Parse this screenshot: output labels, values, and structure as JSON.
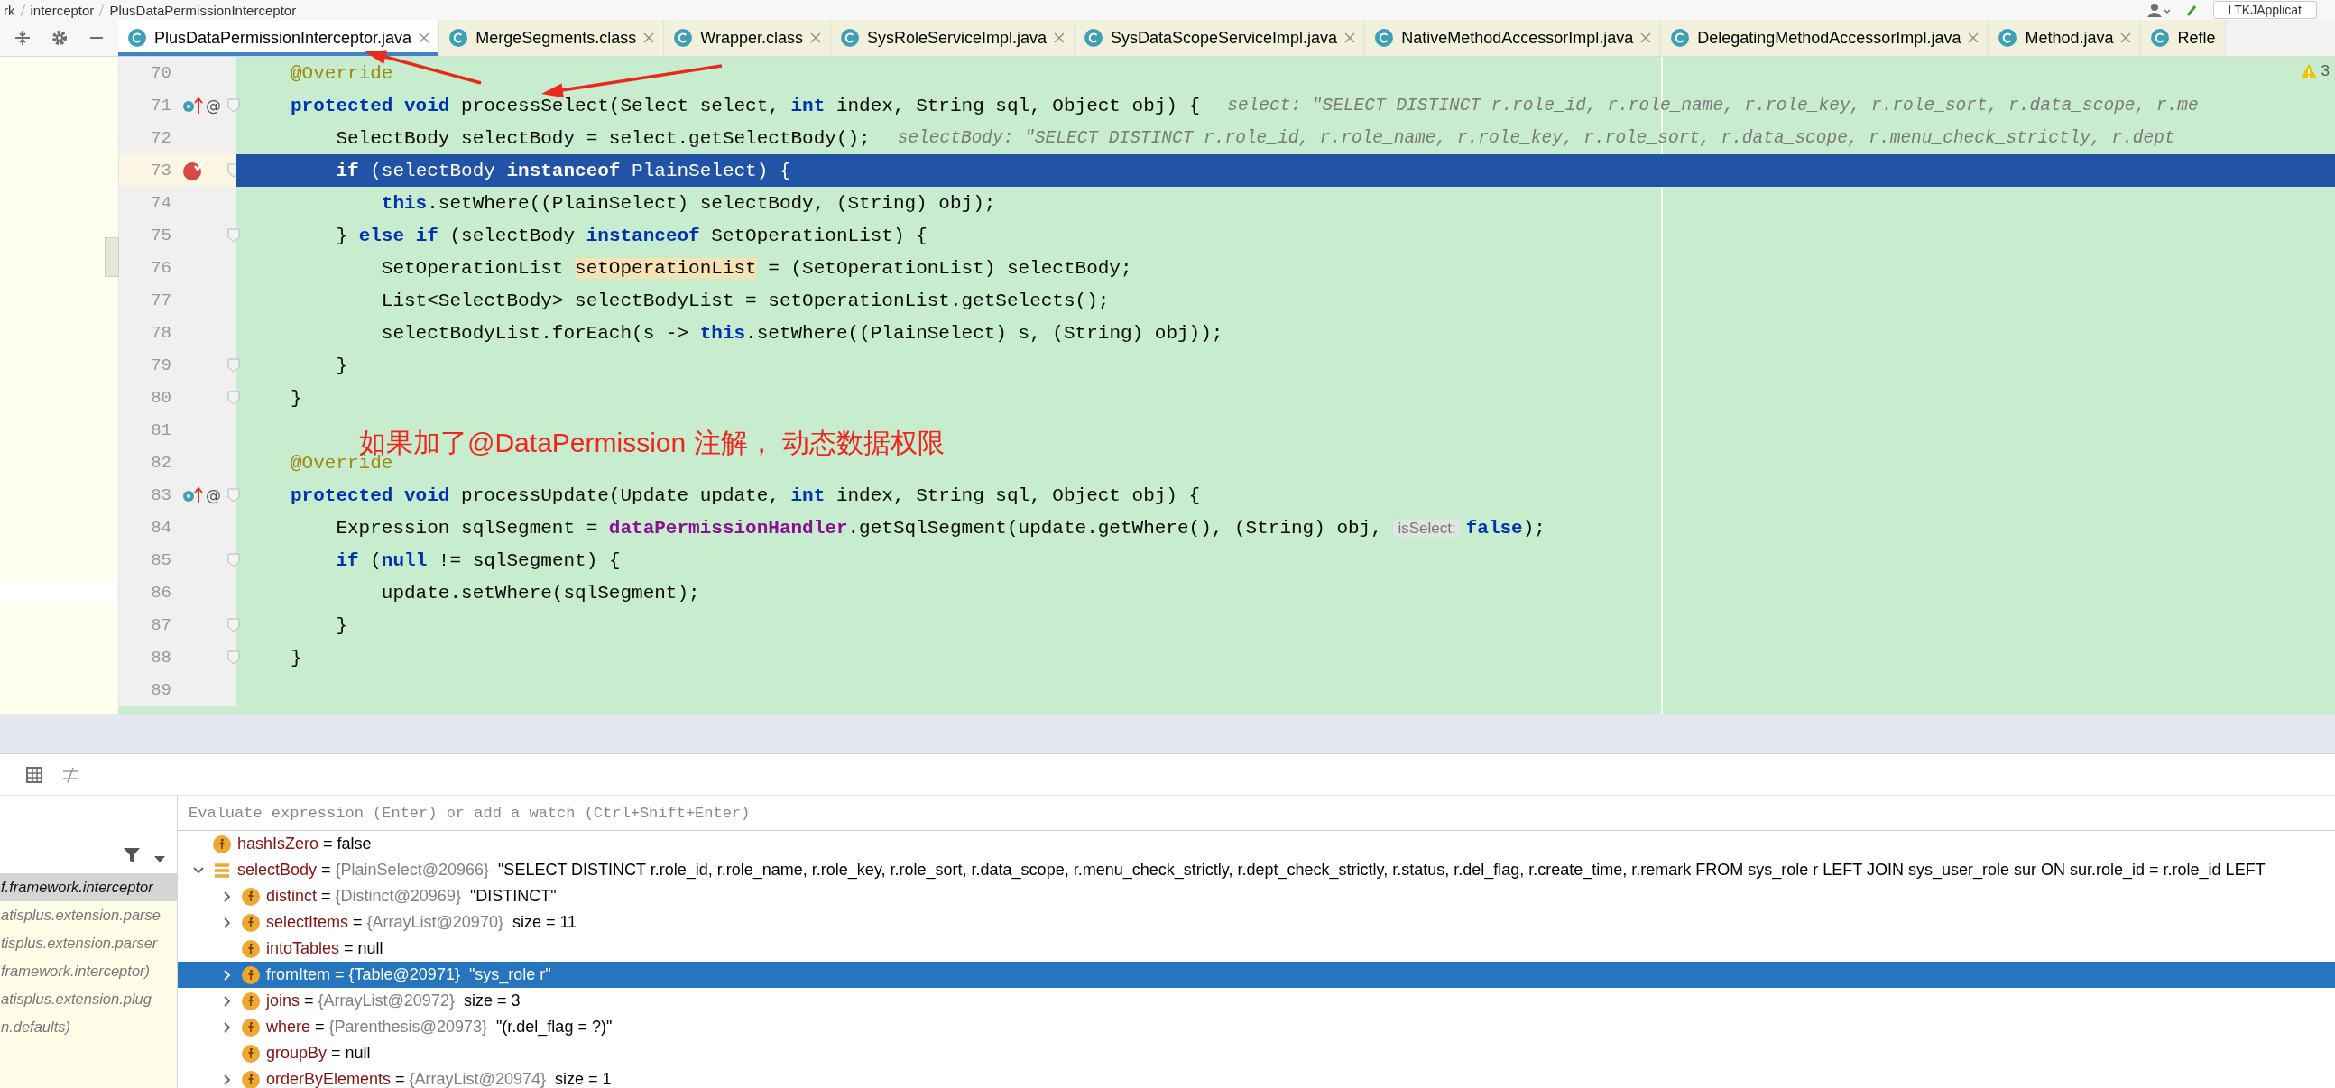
{
  "breadcrumbs": [
    "rk",
    "interceptor",
    "PlusDataPermissionInterceptor"
  ],
  "run_config": {
    "label": "LTKJApplicat"
  },
  "tabs": [
    {
      "label": "PlusDataPermissionInterceptor.java",
      "selected": true
    },
    {
      "label": "MergeSegments.class",
      "selected": false
    },
    {
      "label": "Wrapper.class",
      "selected": false
    },
    {
      "label": "SysRoleServiceImpl.java",
      "selected": false
    },
    {
      "label": "SysDataScopeServiceImpl.java",
      "selected": false
    },
    {
      "label": "NativeMethodAccessorImpl.java",
      "selected": false
    },
    {
      "label": "DelegatingMethodAccessorImpl.java",
      "selected": false
    },
    {
      "label": "Method.java",
      "selected": false
    },
    {
      "label": "Refle",
      "selected": false
    }
  ],
  "editor": {
    "warnings_count": "3",
    "annotation": "如果加了@DataPermission 注解， 动态数据权限",
    "lines": [
      {
        "number": "70",
        "selected": false,
        "breakpoint": false,
        "fold": false,
        "tokens": [
          {
            "kind": "annotation",
            "text": "@Override"
          }
        ]
      },
      {
        "number": "71",
        "selected": false,
        "breakpoint": false,
        "fold": true,
        "override": true,
        "gutter_mark": "@",
        "tokens": [
          {
            "kind": "keyword",
            "text": "protected void"
          },
          {
            "kind": "plain",
            "text": " processSelect(Select select, "
          },
          {
            "kind": "keyword",
            "text": "int"
          },
          {
            "kind": "plain",
            "text": " index, String sql, Object obj) {"
          }
        ],
        "hint": "select: \"SELECT DISTINCT r.role_id, r.role_name, r.role_key, r.role_sort, r.data_scope, r.me"
      },
      {
        "number": "72",
        "selected": false,
        "breakpoint": false,
        "fold": false,
        "tokens": [
          {
            "kind": "plain",
            "text": "    SelectBody selectBody = select.getSelectBody();"
          }
        ],
        "hint": "selectBody: \"SELECT DISTINCT r.role_id, r.role_name, r.role_key, r.role_sort, r.data_scope, r.menu_check_strictly, r.dept"
      },
      {
        "number": "73",
        "selected": true,
        "breakpoint": true,
        "fold": true,
        "tokens": [
          {
            "kind": "keyword",
            "text": "    if"
          },
          {
            "kind": "plain",
            "text": " (selectBody "
          },
          {
            "kind": "keyword",
            "text": "instanceof"
          },
          {
            "kind": "plain",
            "text": " PlainSelect) {"
          }
        ]
      },
      {
        "number": "74",
        "selected": false,
        "breakpoint": false,
        "fold": false,
        "tokens": [
          {
            "kind": "keyword",
            "text": "        this"
          },
          {
            "kind": "plain",
            "text": ".setWhere((PlainSelect) selectBody, (String) obj);"
          }
        ]
      },
      {
        "number": "75",
        "selected": false,
        "breakpoint": false,
        "fold": true,
        "tokens": [
          {
            "kind": "plain",
            "text": "    } "
          },
          {
            "kind": "keyword",
            "text": "else if"
          },
          {
            "kind": "plain",
            "text": " (selectBody "
          },
          {
            "kind": "keyword",
            "text": "instanceof"
          },
          {
            "kind": "plain",
            "text": " SetOperationList) {"
          }
        ]
      },
      {
        "number": "76",
        "selected": false,
        "breakpoint": false,
        "fold": false,
        "tokens": [
          {
            "kind": "plain",
            "text": "        SetOperationList "
          },
          {
            "kind": "highlight",
            "text": "setOperationList"
          },
          {
            "kind": "plain",
            "text": " = (SetOperationList) selectBody;"
          }
        ]
      },
      {
        "number": "77",
        "selected": false,
        "breakpoint": false,
        "fold": false,
        "tokens": [
          {
            "kind": "plain",
            "text": "        List<SelectBody> selectBodyList = setOperationList.getSelects();"
          }
        ]
      },
      {
        "number": "78",
        "selected": false,
        "breakpoint": false,
        "fold": false,
        "tokens": [
          {
            "kind": "plain",
            "text": "        selectBodyList.forEach(s -> "
          },
          {
            "kind": "keyword",
            "text": "this"
          },
          {
            "kind": "plain",
            "text": ".setWhere((PlainSelect) s, (String) obj));"
          }
        ]
      },
      {
        "number": "79",
        "selected": false,
        "breakpoint": false,
        "fold": true,
        "tokens": [
          {
            "kind": "plain",
            "text": "    }"
          }
        ]
      },
      {
        "number": "80",
        "selected": false,
        "breakpoint": false,
        "fold": true,
        "tokens": [
          {
            "kind": "plain",
            "text": "}"
          }
        ]
      },
      {
        "number": "81",
        "selected": false,
        "breakpoint": false,
        "fold": false
      },
      {
        "number": "82",
        "selected": false,
        "breakpoint": false,
        "fold": false,
        "tokens": [
          {
            "kind": "annotation",
            "text": "@Override"
          }
        ]
      },
      {
        "number": "83",
        "selected": false,
        "breakpoint": false,
        "fold": true,
        "override": true,
        "gutter_mark": "@",
        "tokens": [
          {
            "kind": "keyword",
            "text": "protected void"
          },
          {
            "kind": "plain",
            "text": " processUpdate(Update update, "
          },
          {
            "kind": "keyword",
            "text": "int"
          },
          {
            "kind": "plain",
            "text": " index, String sql, Object obj) {"
          }
        ]
      },
      {
        "number": "84",
        "selected": false,
        "breakpoint": false,
        "fold": false,
        "tokens": [
          {
            "kind": "plain",
            "text": "    Expression sqlSegment = "
          },
          {
            "kind": "field",
            "text": "dataPermissionHandler"
          },
          {
            "kind": "plain",
            "text": ".getSqlSegment(update.getWhere(), (String) obj, "
          },
          {
            "kind": "param_hint",
            "text": "isSelect:"
          },
          {
            "kind": "keyword",
            "text": "false"
          },
          {
            "kind": "plain",
            "text": ");"
          }
        ]
      },
      {
        "number": "85",
        "selected": false,
        "breakpoint": false,
        "fold": true,
        "tokens": [
          {
            "kind": "keyword",
            "text": "    if"
          },
          {
            "kind": "plain",
            "text": " ("
          },
          {
            "kind": "keyword",
            "text": "null"
          },
          {
            "kind": "plain",
            "text": " != sqlSegment) {"
          }
        ]
      },
      {
        "number": "86",
        "selected": false,
        "breakpoint": false,
        "fold": false,
        "tokens": [
          {
            "kind": "plain",
            "text": "        update.setWhere(sqlSegment);"
          }
        ]
      },
      {
        "number": "87",
        "selected": false,
        "breakpoint": false,
        "fold": true,
        "tokens": [
          {
            "kind": "plain",
            "text": "    }"
          }
        ]
      },
      {
        "number": "88",
        "selected": false,
        "breakpoint": false,
        "fold": true,
        "tokens": [
          {
            "kind": "plain",
            "text": "}"
          }
        ]
      },
      {
        "number": "89",
        "selected": false,
        "breakpoint": false,
        "fold": false
      }
    ]
  },
  "debugger": {
    "watch_placeholder": "Evaluate expression (Enter) or add a watch (Ctrl+Shift+Enter)",
    "frames": [
      {
        "text": "f.framework.interceptor",
        "selected": true
      },
      {
        "text": "atisplus.extension.parse",
        "selected": false
      },
      {
        "text": "tisplus.extension.parser",
        "selected": false
      },
      {
        "text": "framework.interceptor)",
        "selected": false
      },
      {
        "text": "atisplus.extension.plug",
        "selected": false
      },
      {
        "text": "n.defaults)",
        "selected": false
      }
    ],
    "variables": [
      {
        "name": "hashIsZero",
        "kind": "field",
        "op": "=",
        "value": "false",
        "selected": false
      },
      {
        "name": "selectBody",
        "kind": "list",
        "op": "=",
        "type": "{PlainSelect@20966}",
        "value": "\"SELECT DISTINCT r.role_id, r.role_name, r.role_key, r.role_sort, r.data_scope, r.menu_check_strictly, r.dept_check_strictly, r.status, r.del_flag, r.create_time, r.remark FROM sys_role r LEFT JOIN sys_user_role sur ON sur.role_id = r.role_id LEFT",
        "expanded": true,
        "selected": false,
        "children": [
          {
            "name": "distinct",
            "kind": "field",
            "op": "=",
            "type": "{Distinct@20969}",
            "value": "\"DISTINCT\"",
            "expanded": false,
            "selected": false
          },
          {
            "name": "selectItems",
            "kind": "field",
            "op": "=",
            "type": "{ArrayList@20970}",
            "value": "size = 11",
            "expanded": false,
            "selected": false
          },
          {
            "name": "intoTables",
            "kind": "field",
            "op": "=",
            "value": "null",
            "selected": false
          },
          {
            "name": "fromItem",
            "kind": "field",
            "op": "=",
            "type": "{Table@20971}",
            "value": "\"sys_role r\"",
            "expanded": false,
            "selected": true
          },
          {
            "name": "joins",
            "kind": "field",
            "op": "=",
            "type": "{ArrayList@20972}",
            "value": "size = 3",
            "expanded": false,
            "selected": false
          },
          {
            "name": "where",
            "kind": "field",
            "op": "=",
            "type": "{Parenthesis@20973}",
            "value": "\"(r.del_flag = ?)\"",
            "expanded": false,
            "selected": false
          },
          {
            "name": "groupBy",
            "kind": "field",
            "op": "=",
            "value": "null",
            "selected": false
          },
          {
            "name": "orderByElements",
            "kind": "field",
            "op": "=",
            "type": "{ArrayList@20974}",
            "value": "size = 1",
            "expanded": false,
            "selected": false
          }
        ]
      }
    ]
  }
}
